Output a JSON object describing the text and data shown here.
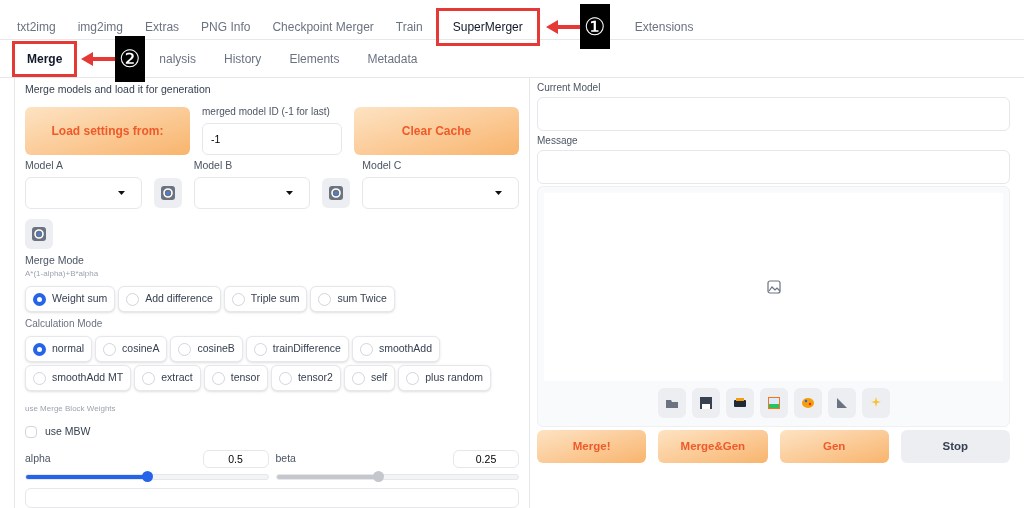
{
  "main_tabs": [
    {
      "label": "txt2img",
      "selected": false,
      "highlighted": false
    },
    {
      "label": "img2img",
      "selected": false,
      "highlighted": false
    },
    {
      "label": "Extras",
      "selected": false,
      "highlighted": false
    },
    {
      "label": "PNG Info",
      "selected": false,
      "highlighted": false
    },
    {
      "label": "Checkpoint Merger",
      "selected": false,
      "highlighted": false
    },
    {
      "label": "Train",
      "selected": false,
      "highlighted": false
    },
    {
      "label": "SuperMerger",
      "selected": true,
      "highlighted": true,
      "badge": "①"
    },
    {
      "label": "Extensions",
      "selected": false,
      "highlighted": false
    }
  ],
  "sub_tabs": [
    {
      "label": "Merge",
      "selected": true,
      "highlighted": true,
      "badge": "②"
    },
    {
      "label": "nalysis",
      "selected": false,
      "highlighted": false
    },
    {
      "label": "History",
      "selected": false,
      "highlighted": false
    },
    {
      "label": "Elements",
      "selected": false,
      "highlighted": false
    },
    {
      "label": "Metadata",
      "selected": false,
      "highlighted": false
    }
  ],
  "left": {
    "description": "Merge models and load it for generation",
    "load_button": "Load settings from:",
    "model_id": {
      "label": "merged model ID (-1 for last)",
      "value": "-1"
    },
    "clear_button": "Clear Cache",
    "models": [
      {
        "label": "Model A"
      },
      {
        "label": "Model B"
      },
      {
        "label": "Model C"
      }
    ],
    "merge_mode": {
      "label": "Merge Mode",
      "formula": "A*(1-alpha)+B*alpha",
      "options": [
        {
          "label": "Weight sum",
          "selected": true
        },
        {
          "label": "Add difference",
          "selected": false
        },
        {
          "label": "Triple sum",
          "selected": false
        },
        {
          "label": "sum Twice",
          "selected": false
        }
      ]
    },
    "calc_mode": {
      "label": "Calculation Mode",
      "options": [
        {
          "label": "normal",
          "selected": true
        },
        {
          "label": "cosineA",
          "selected": false
        },
        {
          "label": "cosineB",
          "selected": false
        },
        {
          "label": "trainDifference",
          "selected": false
        },
        {
          "label": "smoothAdd",
          "selected": false
        },
        {
          "label": "smoothAdd MT",
          "selected": false
        },
        {
          "label": "extract",
          "selected": false
        },
        {
          "label": "tensor",
          "selected": false
        },
        {
          "label": "tensor2",
          "selected": false
        },
        {
          "label": "self",
          "selected": false
        },
        {
          "label": "plus random",
          "selected": false
        }
      ]
    },
    "mbw": {
      "hint": "use Merge Block Weights",
      "label": "use MBW",
      "checked": false
    },
    "sliders": [
      {
        "label": "alpha",
        "value": "0.5",
        "level": 0.5,
        "disabled": false
      },
      {
        "label": "beta",
        "value": "0.25",
        "level": 0.42,
        "disabled": true
      }
    ]
  },
  "right": {
    "current_model": {
      "label": "Current Model"
    },
    "message": {
      "label": "Message"
    },
    "actions": [
      {
        "label": "Merge!",
        "kind": "primary"
      },
      {
        "label": "Merge&Gen",
        "kind": "primary"
      },
      {
        "label": "Gen",
        "kind": "primary"
      },
      {
        "label": "Stop",
        "kind": "secondary"
      }
    ]
  }
}
